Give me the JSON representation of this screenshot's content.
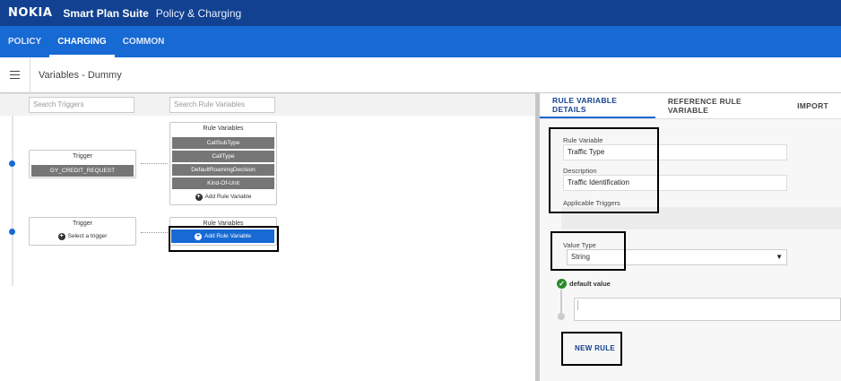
{
  "topbar": {
    "logo": "NOKIA",
    "suite": "Smart Plan Suite",
    "module": "Policy & Charging"
  },
  "nav": {
    "tabs": [
      {
        "label": "POLICY"
      },
      {
        "label": "CHARGING"
      },
      {
        "label": "COMMON"
      }
    ],
    "active": "CHARGING"
  },
  "page": {
    "title": "Variables - Dummy"
  },
  "search": {
    "triggers_placeholder": "Search Triggers",
    "rule_variables_placeholder": "Search Rule Variables"
  },
  "flow": {
    "row1": {
      "trigger_header": "Trigger",
      "trigger_value": "GY_CREDIT_REQUEST",
      "rule_variables_header": "Rule Variables",
      "rule_variables": [
        "CallSubType",
        "CallType",
        "DefaultRoamingDecision",
        "Kind-Of-Unit"
      ],
      "add_rule_variable": "Add Rule Variable"
    },
    "row2": {
      "trigger_header": "Trigger",
      "select_trigger": "Select a trigger",
      "rule_variables_header": "Rule Variables",
      "add_rule_variable": "Add Rule Variable"
    }
  },
  "details": {
    "tabs": [
      {
        "label": "RULE VARIABLE DETAILS"
      },
      {
        "label": "REFERENCE RULE VARIABLE"
      },
      {
        "label": "IMPORT"
      }
    ],
    "rule_variable_label": "Rule Variable",
    "rule_variable_value": "Traffic Type",
    "description_label": "Description",
    "description_value": "Traffic Identification",
    "applicable_triggers_label": "Applicable Triggers",
    "value_type_label": "Value Type",
    "value_type_value": "String",
    "default_value_label": "default value",
    "new_rule": "NEW RULE"
  },
  "colors": {
    "topbar": "#124191",
    "navbar": "#1769d4",
    "accent": "#1769d4",
    "pill": "#767676",
    "check": "#2a8a2a"
  }
}
